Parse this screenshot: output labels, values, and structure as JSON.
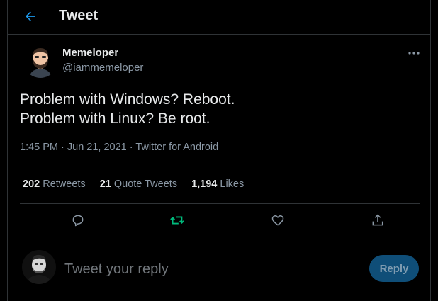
{
  "header": {
    "title": "Tweet"
  },
  "author": {
    "name": "Memeloper",
    "handle": "@iammemeloper"
  },
  "tweet": {
    "lines": [
      "Problem with Windows? Reboot.",
      "Problem with Linux? Be root."
    ],
    "meta": "1:45 PM · Jun 21, 2021 · Twitter for Android"
  },
  "stats": {
    "retweets_count": "202",
    "retweets_label": "Retweets",
    "quotes_count": "21",
    "quotes_label": "Quote Tweets",
    "likes_count": "1,194",
    "likes_label": "Likes"
  },
  "reply": {
    "placeholder": "Tweet your reply",
    "button_label": "Reply"
  },
  "colors": {
    "accent": "#1d9bf0",
    "retweet_active": "#00ba7c",
    "icon": "#8b98a5",
    "border": "#2f3336"
  },
  "icons": [
    "back-arrow-icon",
    "more-icon",
    "reply-icon",
    "retweet-icon",
    "like-icon",
    "share-icon"
  ]
}
